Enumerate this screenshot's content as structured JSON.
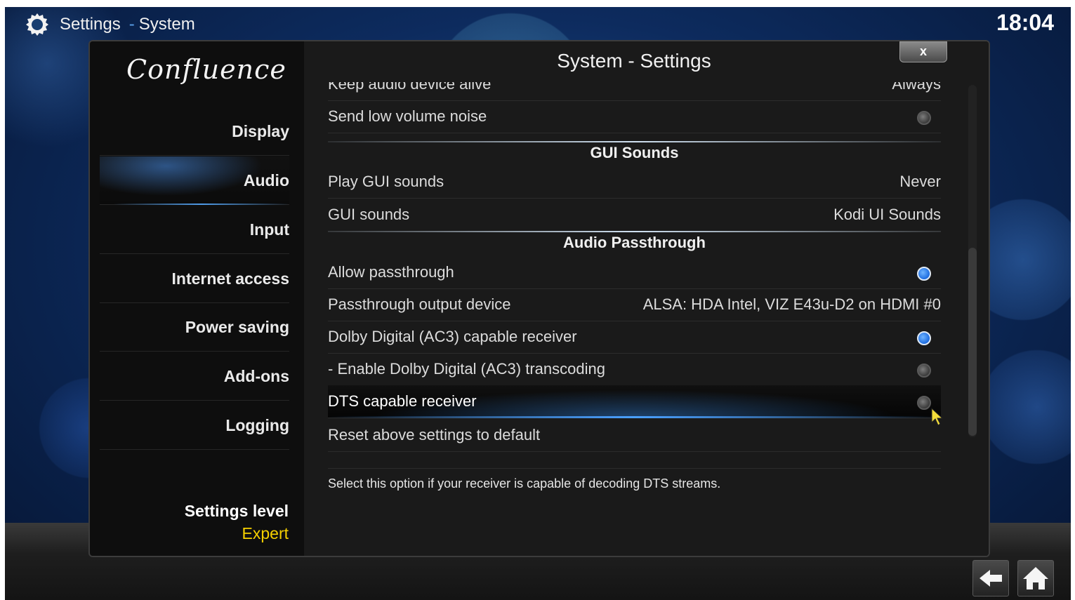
{
  "header": {
    "app_icon": "gear-icon",
    "breadcrumb_main": "Settings",
    "breadcrumb_separator": "-",
    "breadcrumb_sub": "System",
    "clock": "18:04"
  },
  "logo_text": "Confluence",
  "sidebar": {
    "items": [
      {
        "label": "Display"
      },
      {
        "label": "Audio"
      },
      {
        "label": "Input"
      },
      {
        "label": "Internet access"
      },
      {
        "label": "Power saving"
      },
      {
        "label": "Add-ons"
      },
      {
        "label": "Logging"
      }
    ],
    "active_item": "Audio",
    "settings_level_label": "Settings level",
    "settings_level_value": "Expert"
  },
  "content": {
    "title": "System - Settings",
    "close_label": "x",
    "rows": [
      {
        "label": "Keep audio device alive",
        "value": "Always"
      },
      {
        "label": "Send low volume noise",
        "toggle": false
      },
      {
        "section": "GUI Sounds"
      },
      {
        "label": "Play GUI sounds",
        "value": "Never"
      },
      {
        "label": "GUI sounds",
        "value": "Kodi UI Sounds"
      },
      {
        "section": "Audio Passthrough"
      },
      {
        "label": "Allow passthrough",
        "toggle": true
      },
      {
        "label": "Passthrough output device",
        "value": "ALSA: HDA Intel, VIZ E43u-D2 on HDMI #0"
      },
      {
        "label": "Dolby Digital (AC3) capable receiver",
        "toggle": true
      },
      {
        "label": "- Enable Dolby Digital (AC3) transcoding",
        "toggle": false
      },
      {
        "label": "DTS capable receiver",
        "toggle": false,
        "focused": true
      },
      {
        "label": "Reset above settings to default"
      }
    ],
    "description": "Select this option if your receiver is capable of decoding DTS streams."
  },
  "bottom_nav": {
    "back_icon": "back-arrow-icon",
    "home_icon": "home-icon"
  },
  "colors": {
    "accent": "#4a9be8",
    "settings_level": "#f5d000",
    "toggle_on": "#1c6be0"
  }
}
